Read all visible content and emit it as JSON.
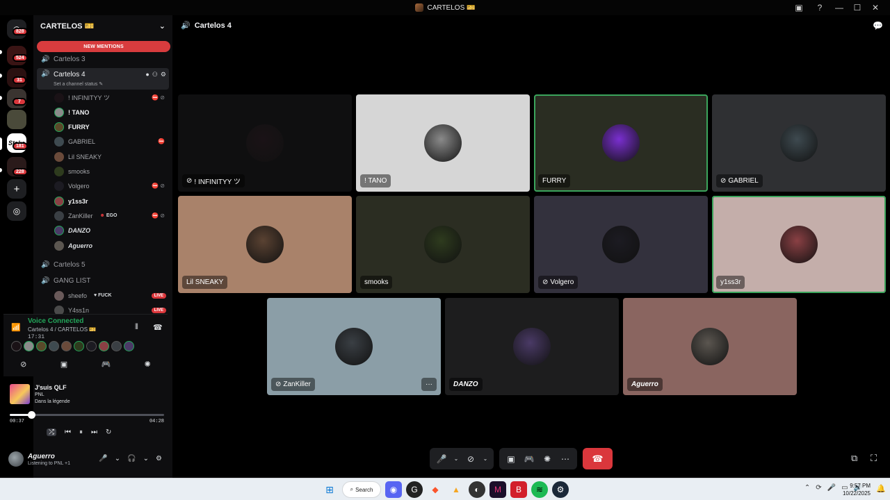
{
  "window": {
    "title": "CARTELOS 🎫"
  },
  "rail": {
    "badges": [
      "828",
      "524",
      "31",
      "7",
      "181",
      "228"
    ]
  },
  "sidebar": {
    "guild_name": "CARTELOS 🎫",
    "new_mentions": "NEW MENTIONS",
    "channels": {
      "cartelos3": "Cartelos 3",
      "cartelos4": "Cartelos 4",
      "cartelos4_status": "Set a channel status",
      "cartelos5": "Cartelos 5",
      "ganglist": "GANG LIST"
    },
    "members": [
      {
        "name": "! INFINITYY ツ",
        "style": "normal",
        "tail": "⛔⊘"
      },
      {
        "name": "! TANO",
        "style": "bold",
        "tail": ""
      },
      {
        "name": "FURRY",
        "style": "bold",
        "tail": ""
      },
      {
        "name": "GABRIEL",
        "style": "normal",
        "tail": "⛔"
      },
      {
        "name": "Lil SNEAKY",
        "style": "normal",
        "tail": ""
      },
      {
        "name": "smooks",
        "style": "normal",
        "tail": ""
      },
      {
        "name": "Volgero",
        "style": "normal",
        "tail": "⛔⊘"
      },
      {
        "name": "y1ss3r",
        "style": "bold",
        "tail": ""
      },
      {
        "name": "ZanKiller",
        "style": "normal",
        "tail": "⛔⊘"
      },
      {
        "name": "DANZO",
        "style": "italic",
        "tail": ""
      },
      {
        "name": "Aguerro",
        "style": "italic",
        "tail": ""
      }
    ],
    "zankiller_tag": "EGO",
    "gang_members": [
      {
        "name": "sheefo",
        "tag": "FUCK",
        "live": "LIVE"
      },
      {
        "name": "Y4ss1n",
        "tag": "",
        "live": "LIVE"
      }
    ]
  },
  "voice": {
    "title": "Voice Connected",
    "subtitle": "Cartelos 4 / CARTELOS 🎫",
    "time": "17:31"
  },
  "music": {
    "song": "J'suis QLF",
    "artist": "PNL",
    "album": "Dans la légende",
    "elapsed": "00:37",
    "duration": "04:28",
    "progress": 0.138
  },
  "user": {
    "name": "Aguerro",
    "status": "Listening to PNL +1"
  },
  "main": {
    "channel_title": "Cartelos 4"
  },
  "tiles": [
    {
      "name": "! INFINITYY ツ",
      "bg": "#0f0f10",
      "av": "#1a1216",
      "muted": true,
      "italic": false,
      "speaking": false
    },
    {
      "name": "! TANO",
      "bg": "#d6d6d6",
      "av": "#8a8a8a",
      "muted": false,
      "italic": false,
      "speaking": false
    },
    {
      "name": "FURRY",
      "bg": "#2a2d22",
      "av": "#7a2fd0",
      "muted": false,
      "italic": false,
      "speaking": true
    },
    {
      "name": "GABRIEL",
      "bg": "#2f3033",
      "av": "#3e4a50",
      "muted": true,
      "italic": false,
      "speaking": false
    },
    {
      "name": "Lil SNEAKY",
      "bg": "#a9826a",
      "av": "#5a4232",
      "muted": false,
      "italic": false,
      "speaking": false
    },
    {
      "name": "smooks",
      "bg": "#2b2d22",
      "av": "#2e3b1e",
      "muted": false,
      "italic": false,
      "speaking": false
    },
    {
      "name": "Volgero",
      "bg": "#33313d",
      "av": "#1c1b22",
      "muted": true,
      "italic": false,
      "speaking": false
    },
    {
      "name": "y1ss3r",
      "bg": "#c4aeaa",
      "av": "#8a4044",
      "muted": false,
      "italic": false,
      "speaking": true
    },
    {
      "name": "ZanKiller",
      "bg": "#8b9ea7",
      "av": "#3a3f44",
      "muted": true,
      "italic": false,
      "speaking": false
    },
    {
      "name": "DANZO",
      "bg": "#1d1d1e",
      "av": "#4a3a66",
      "muted": false,
      "italic": true,
      "speaking": false
    },
    {
      "name": "Aguerro",
      "bg": "#8a6560",
      "av": "#5b5650",
      "muted": false,
      "italic": true,
      "speaking": false
    }
  ],
  "tile_more": "···",
  "taskbar": {
    "search": "Search",
    "time": "9:57 PM",
    "date": "10/22/2025"
  },
  "colors": {
    "accent_green": "#23a55a",
    "danger_red": "#da373c",
    "sidebar_bg": "#0e0e10"
  }
}
